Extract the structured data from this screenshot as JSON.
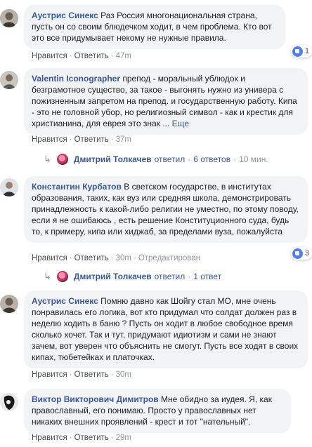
{
  "comments": [
    {
      "author": "Аустрис Синекс",
      "text": " Раз Россия многонациональная страна, пусть он со своим блюдечком ходит, в чем проблема. Кто вот это все придумывает некому не нужные правила.",
      "like_label": "Нравится",
      "reply_label": "Ответить",
      "time": "47m",
      "reaction_count": "1"
    },
    {
      "author": "Valentin Iconographer",
      "text": " препод - моральный ублюдок и безграмотное существо, за такое - выгонять нужно из универа с пожизненным запретом на препод. и государственную работу. Кипа - это не головной убор, но религиозный символ - как и крестик для христианина, для еврея это знак ...",
      "more_label": "Еще",
      "like_label": "Нравится",
      "reply_label": "Ответить",
      "time": "37m"
    },
    {
      "author": "Константин Курбатов",
      "text": " В светском государстве, в институтах образования, таких, как вуз или средняя школа, демонстрировать принадлежность к какой-либо религии не уместно, по этому поводу, если я не ошибаюсь , есть решение Конституционного суда, будь то, к примеру, кипа или хиджаб, за пределами вуза, пожалуйста",
      "like_label": "Нравится",
      "reply_label": "Ответить",
      "time": "30m",
      "edited_label": "Отредактирован",
      "reaction_count": "3"
    },
    {
      "author": "Аустрис Синекс",
      "text": " Помню давно как Шойгу стал МО, мне очень понравилась его логика, вот кто придумал что солдат должен раз в неделю ходить в баню ? Пусть он ходит в любое свободное время сколько хочет. Так и тут, придумают идиотизм и сами не знают зачем, вот уверен что объяснить не смогут. Пусть все ходят в своих кипах, тюбетейках и платочках.",
      "like_label": "Нравится",
      "reply_label": "Ответить",
      "time": "30m"
    },
    {
      "author": "Виктор Викторович Димитров",
      "text": " Мне обидно за иудея. Я, как православный, его понимаю. Просто у православных нет никаких внешних проявлений - крест и тот \"нательный\".",
      "like_label": "Нравится",
      "reply_label": "Ответить",
      "time": "29m"
    }
  ],
  "reply_threads": [
    {
      "name": "Дмитрий Толкачев",
      "action": "ответил",
      "count": "6 ответов",
      "time": "10 мин."
    },
    {
      "name": "Дмитрий Толкачев",
      "action": "ответил",
      "count": "1 ответ"
    }
  ],
  "colors": {
    "link": "#385898",
    "bubble": "#f2f3f5",
    "muted": "#90949c",
    "like": "#4e80f1"
  }
}
